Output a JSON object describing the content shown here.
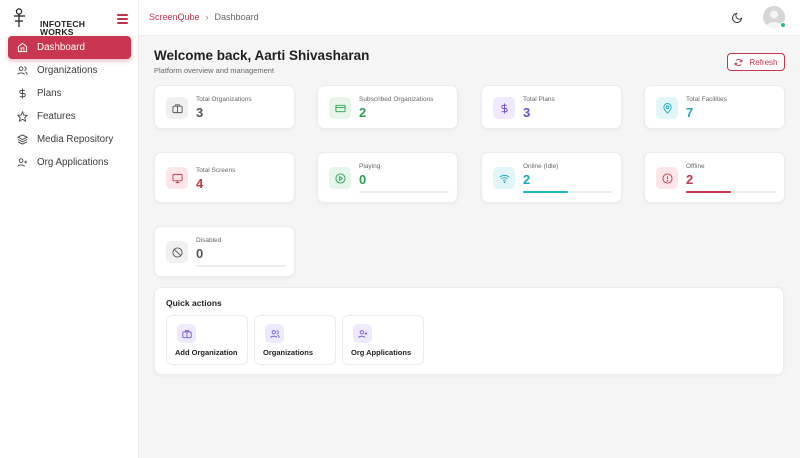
{
  "brand": {
    "line1": "INFOTECH",
    "line2": "WORKS"
  },
  "sidebar": {
    "items": [
      {
        "label": "Dashboard",
        "icon": "home-icon",
        "active": true
      },
      {
        "label": "Organizations",
        "icon": "users-icon"
      },
      {
        "label": "Plans",
        "icon": "dollar-icon"
      },
      {
        "label": "Features",
        "icon": "star-icon"
      },
      {
        "label": "Media Repository",
        "icon": "layers-icon"
      },
      {
        "label": "Org Applications",
        "icon": "user-plus-icon"
      }
    ]
  },
  "breadcrumb": {
    "root": "ScreenQube",
    "current": "Dashboard"
  },
  "header": {
    "welcome": "Welcome back, Aarti Shivasharan",
    "subtitle": "Platform overview and management",
    "refresh_label": "Refresh"
  },
  "stats": [
    {
      "label": "Total Organizations",
      "value": "3",
      "icon": "briefcase-icon",
      "color": "#555555",
      "bg": "#f0f0f2"
    },
    {
      "label": "Subscribed Organizations",
      "value": "2",
      "icon": "credit-card-icon",
      "color": "#2e9e4f",
      "bg": "#e6f6ea"
    },
    {
      "label": "Total Plans",
      "value": "3",
      "icon": "dollar-icon",
      "color": "#6a4fd8",
      "bg": "#efeafc"
    },
    {
      "label": "Total Facilities",
      "value": "7",
      "icon": "map-pin-icon",
      "color": "#1aa8bd",
      "bg": "#e2f6f9"
    },
    {
      "label": "Total Screens",
      "value": "4",
      "icon": "monitor-icon",
      "color": "#c9364f",
      "bg": "#fce6ea"
    },
    {
      "label": "Playing",
      "value": "0",
      "icon": "play-circle-icon",
      "color": "#2e9e4f",
      "bg": "#e6f6ea",
      "progress": 0
    },
    {
      "label": "Online (Idle)",
      "value": "2",
      "icon": "wifi-icon",
      "color": "#1aa8bd",
      "bg": "#e2f6f9",
      "progress": 0.5
    },
    {
      "label": "Offline",
      "value": "2",
      "icon": "alert-circle-icon",
      "color": "#c9364f",
      "bg": "#fce6ea",
      "progress": 0.5
    },
    {
      "label": "Disabled",
      "value": "0",
      "icon": "ban-icon",
      "color": "#555555",
      "bg": "#f0f0f2",
      "progress": 0
    }
  ],
  "quick_actions": {
    "title": "Quick actions",
    "items": [
      {
        "label": "Add Organization",
        "icon": "briefcase-icon"
      },
      {
        "label": "Organizations",
        "icon": "users-icon"
      },
      {
        "label": "Org Applications",
        "icon": "user-plus-icon"
      }
    ]
  },
  "colors": {
    "accent": "#c9364f",
    "online": "#2eb872"
  }
}
